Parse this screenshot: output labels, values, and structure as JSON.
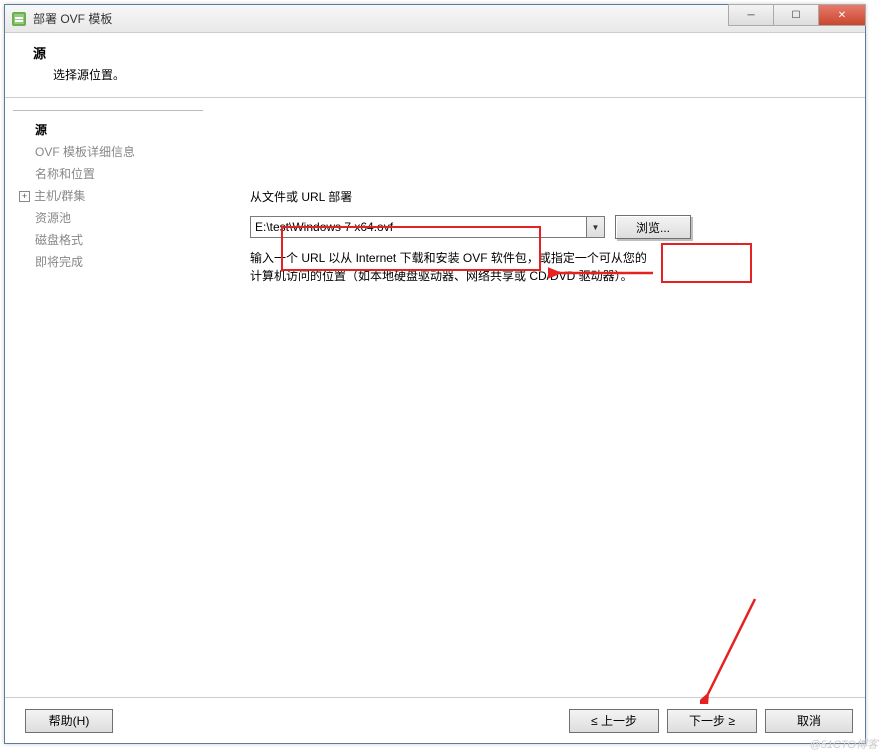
{
  "title_bar": {
    "title": "部署 OVF 模板"
  },
  "window_controls": {
    "min": "─",
    "max": "☐",
    "close": "✕"
  },
  "header": {
    "title": "源",
    "subtitle": "选择源位置。"
  },
  "sidebar": {
    "items": [
      {
        "label": "源",
        "active": true,
        "expand": null
      },
      {
        "label": "OVF 模板详细信息",
        "active": false,
        "expand": null
      },
      {
        "label": "名称和位置",
        "active": false,
        "expand": null
      },
      {
        "label": "主机/群集",
        "active": false,
        "expand": "plus"
      },
      {
        "label": "资源池",
        "active": false,
        "expand": null
      },
      {
        "label": "磁盘格式",
        "active": false,
        "expand": null
      },
      {
        "label": "即将完成",
        "active": false,
        "expand": null
      }
    ]
  },
  "main": {
    "field_label": "从文件或 URL 部署",
    "path_value": "E:\\test\\Windows 7 x64.ovf",
    "browse_label": "浏览...",
    "help_text_line1": "输入一个 URL 以从 Internet 下载和安装 OVF 软件包，或指定一个可从您的",
    "help_text_line2": "计算机访问的位置（如本地硬盘驱动器、网络共享或 CD/DVD 驱动器）。"
  },
  "footer": {
    "help_label": "帮助(H)",
    "back_label": "≤ 上一步",
    "next_label": "下一步 ≥",
    "cancel_label": "取消"
  },
  "watermark": "@51CTO博客"
}
